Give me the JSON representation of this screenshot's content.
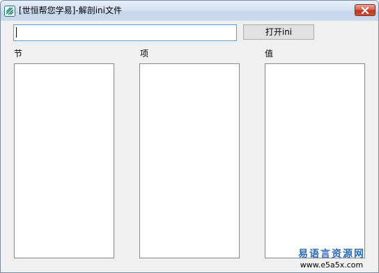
{
  "window": {
    "title": "[世恒帮您学易]-解剖ini文件",
    "app_icon": "app-logo-icon",
    "close_icon": "close-icon"
  },
  "toolbar": {
    "path_input_value": "",
    "open_button_label": "打开ini"
  },
  "columns": [
    {
      "label": "节",
      "items": []
    },
    {
      "label": "项",
      "items": []
    },
    {
      "label": "值",
      "items": []
    }
  ],
  "watermark": {
    "name": "易语言资源网",
    "url": "www.e5a5x.com"
  },
  "colors": {
    "titlebar": "#d6e2f1",
    "close_button": "#c7432b",
    "input_focus_border": "#569de5",
    "watermark_text": "#2a6ab8"
  }
}
